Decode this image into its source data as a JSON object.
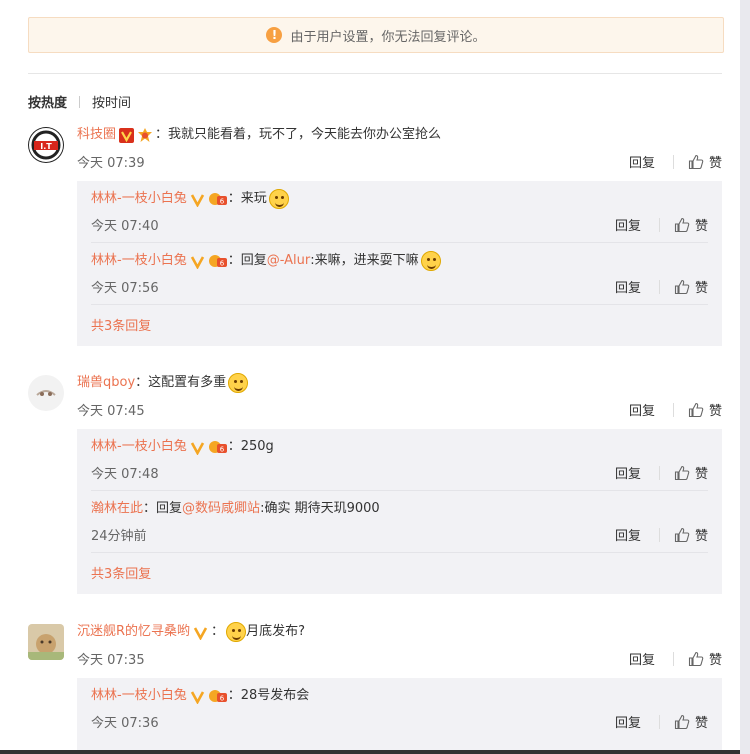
{
  "notice": {
    "text": "由于用户设置，你无法回复评论。"
  },
  "sort": {
    "hot": "按热度",
    "time": "按时间"
  },
  "actions": {
    "reply": "回复",
    "like": "赞"
  },
  "colors": {
    "accent": "#eb7350",
    "notice_bg": "#fdf6ec",
    "icon_orange": "#f7a042"
  },
  "comments": [
    {
      "user": "科技圈",
      "sep": "：",
      "text": "我就只能看着，玩不了，今天能去你办公室抢么",
      "time": "今天 07:39",
      "avatar_text": "I.T",
      "replies": [
        {
          "user": "林林-一枝小白兔",
          "sep": "：",
          "prefix": "",
          "mention": "",
          "text": "来玩",
          "time": "今天 07:40"
        },
        {
          "user": "林林-一枝小白兔",
          "sep": "：",
          "prefix": "回复",
          "mention": "@-Alur",
          "text": ":来嘛，进来耍下嘛",
          "time": "今天 07:56"
        }
      ],
      "more": "共3条回复"
    },
    {
      "user": "瑞兽qboy",
      "sep": "：",
      "text": "这配置有多重",
      "time": "今天 07:45",
      "replies": [
        {
          "user": "林林-一枝小白兔",
          "sep": "：",
          "prefix": "",
          "mention": "",
          "text": "250g",
          "time": "今天 07:48"
        },
        {
          "user": "瀚林在此",
          "sep": "：",
          "prefix": "回复",
          "mention": "@数码咸卿站",
          "text": ":确实 期待天玑9000",
          "time": "24分钟前"
        }
      ],
      "more": "共3条回复"
    },
    {
      "user": "沉迷舰R的忆寻桑哟",
      "sep": "：",
      "text": "月底发布?",
      "time": "今天 07:35",
      "replies": [
        {
          "user": "林林-一枝小白兔",
          "sep": "：",
          "prefix": "",
          "mention": "",
          "text": "28号发布会",
          "time": "今天 07:36"
        }
      ]
    }
  ]
}
